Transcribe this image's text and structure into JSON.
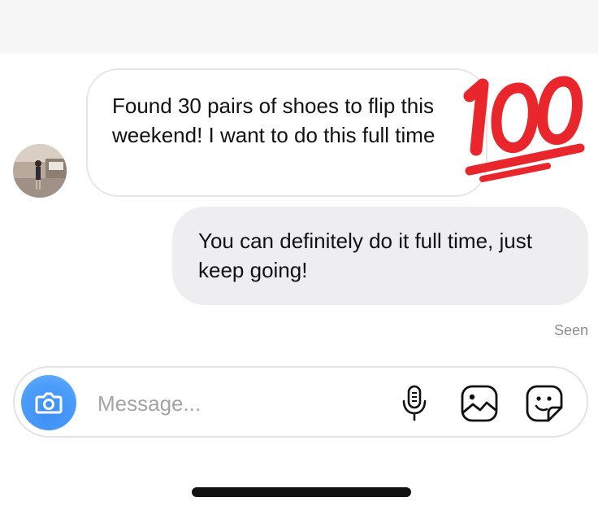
{
  "colors": {
    "outgoing_bubble": "#eeeef0",
    "incoming_bubble_border": "#e6e6e6",
    "camera_button": "#3e8ef7",
    "emoji_red": "#e8262c",
    "seen_text": "#8e8e93"
  },
  "conversation": {
    "incoming": {
      "avatar_icon": "contact-avatar",
      "text": "Found 30 pairs of shoes to flip this weekend! I want to do this full time",
      "reaction_icon": "hundred-points-emoji"
    },
    "outgoing": {
      "text": "You can definitely do it full time, just keep going!"
    },
    "status": "Seen"
  },
  "composer": {
    "camera_icon": "camera-icon",
    "placeholder": "Message...",
    "value": "",
    "mic_icon": "microphone-icon",
    "gallery_icon": "image-icon",
    "sticker_icon": "sticker-icon"
  }
}
